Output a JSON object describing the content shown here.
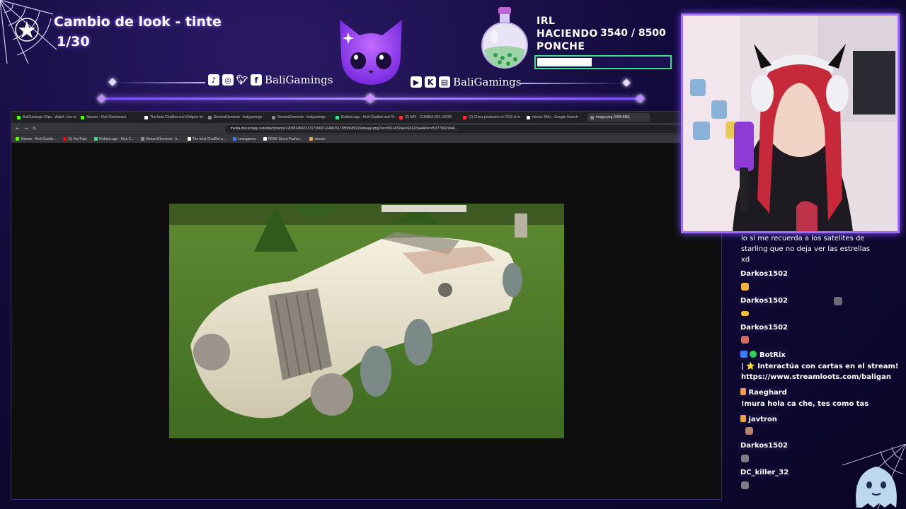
{
  "overlay": {
    "goal_title": "Cambio de look - tinte",
    "goal_count": "1/30",
    "social_left_name": "BaliGamings",
    "social_right_name": "BaliGamings",
    "social_left_icons": [
      "tiktok-icon",
      "instagram-icon",
      "twitter-icon",
      "facebook-icon"
    ],
    "social_right_icons": [
      "youtube-icon",
      "kick-icon",
      "twitch-icon"
    ],
    "irl_line1": "IRL",
    "irl_line2": "HACIENDO",
    "irl_line3": "PONCHE",
    "irl_progress": "3540  / 8500",
    "irl_fraction": 0.416,
    "accent": "#8a5cff",
    "bar_color": "#3ee08a"
  },
  "browser": {
    "tabs": [
      "BaliGamings Clips - Watch Live on",
      "Stream - Kick Dashboard",
      "The best ChatBot and Widgets for",
      "StreamElements - baligamings",
      "StreamElements - baligamings",
      "Kickbot.app - Kick Chatbot and Or",
      "(2) MIX - CUMBIA DEL VERA",
      "(2) China producirá en 2023 al m",
      "nissan 350z - Google Search",
      "image.png (948×580)"
    ],
    "url": "media.discordapp.net/attachments/1209814592313172060/1248876178558685215/image.png?ex=6814182&is=6812c6a4&hm=f91778d21b46...",
    "bookmarks": [
      "Stream - Kick Dashb...",
      "(1) YouTube",
      "Kickbot.app - Kick C...",
      "StreamElements - b...",
      "The best ChatBot a...",
      "Lexogames",
      "PEAK Scout Pusher...",
      "stream"
    ]
  },
  "chat": {
    "partial_message_line1": "lo si me recuerda a los satelites de",
    "partial_message_line2": "starling que no deja ver las estrellas",
    "partial_message_line3": "xd",
    "messages": [
      {
        "user": "Darkos1502",
        "text": ""
      },
      {
        "user": "Darkos1502",
        "text": ""
      },
      {
        "user": "Darkos1502",
        "text": ""
      },
      {
        "user": "BotRix",
        "text_line1": "| ⭐ Interactúa con cartas en el stream!",
        "text_line2": "https://www.streamloots.com/baligan"
      },
      {
        "user": "Raeghard",
        "text": "!mura hola ca che, tes como tas"
      },
      {
        "user": "javtron",
        "text": ""
      },
      {
        "user": "Darkos1502",
        "text": ""
      },
      {
        "user": "DC_killer_32",
        "text": ""
      }
    ]
  }
}
